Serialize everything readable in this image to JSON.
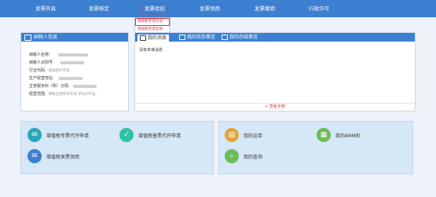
{
  "nav": {
    "items": [
      {
        "label": "发票开具"
      },
      {
        "label": "发票核定"
      },
      {
        "label": "发票验旧"
      },
      {
        "label": "发票领用"
      },
      {
        "label": "发票缴销"
      },
      {
        "label": "行政许可"
      }
    ],
    "active_index": 2,
    "dropdown": [
      "增值税专票验旧",
      "增值税普票验旧"
    ]
  },
  "taxpayer": {
    "title": "纳税人信息",
    "fields": [
      {
        "label": "纳税人名称:"
      },
      {
        "label": "纳税人识别号:"
      },
      {
        "label": "行业代码:",
        "value": "基础软件开发..."
      },
      {
        "label": "生产经营地址:"
      },
      {
        "label": "主管税务科（所）分局:"
      },
      {
        "label": "经营范围:",
        "value": "网络应用软件开发;手机APP运..."
      }
    ]
  },
  "messages": {
    "tabs": [
      {
        "label": "我的消息",
        "icon": "message-icon"
      },
      {
        "label": "我的待办事宜",
        "icon": "todo-icon"
      },
      {
        "label": "我的办结事宜",
        "icon": "done-icon"
      }
    ],
    "active_tab": 0,
    "empty_text": "没有未读消息",
    "more_label": "+ 查看全部"
  },
  "functions_left": [
    {
      "label": "增值税专票代开申请",
      "icon": "envelope-icon",
      "color": "#2aa6b8"
    },
    {
      "label": "增值税普票代开申请",
      "icon": "check-icon",
      "color": "#2fc2a5"
    },
    {
      "label": "增值税发票领用",
      "icon": "envelope-icon",
      "color": "#3d7fd0"
    }
  ],
  "functions_right": [
    {
      "label": "我的运单",
      "icon": "clipboard-icon",
      "color": "#e3a63a"
    },
    {
      "label": "我的ARM机",
      "icon": "calculator-icon",
      "color": "#6cbc5a"
    },
    {
      "label": "我的查询",
      "icon": "search-icon",
      "color": "#6cbc5a"
    }
  ],
  "colors": {
    "primary": "#3d7fd0",
    "accent_red": "#d9373b",
    "background": "#eef3f9"
  }
}
